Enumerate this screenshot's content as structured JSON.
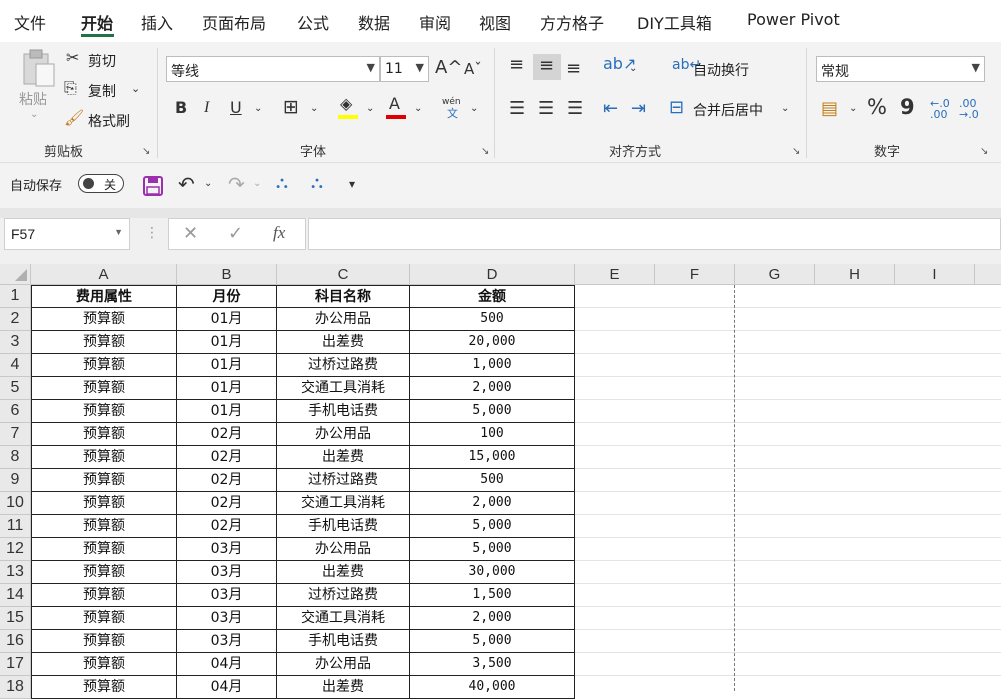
{
  "tabs": [
    "文件",
    "开始",
    "插入",
    "页面布局",
    "公式",
    "数据",
    "审阅",
    "视图",
    "方方格子",
    "DIY工具箱",
    "Power Pivot"
  ],
  "active_tab": "开始",
  "ribbon": {
    "clipboard": {
      "paste": "粘贴",
      "cut": "剪切",
      "copy": "复制",
      "format_painter": "格式刷",
      "group": "剪贴板"
    },
    "font": {
      "name": "等线",
      "size": "11",
      "bold": "B",
      "italic": "I",
      "underline": "U",
      "pinyin": "wén",
      "group": "字体"
    },
    "alignment": {
      "wrap_text": "自动换行",
      "merge_center": "合并后居中",
      "group": "对齐方式"
    },
    "number": {
      "format": "常规",
      "percent": "%",
      "comma": "9",
      "group": "数字"
    }
  },
  "qat": {
    "autosave_label": "自动保存",
    "autosave_state": "关"
  },
  "formula_bar": {
    "name_box": "F57",
    "formula": ""
  },
  "columns": [
    "A",
    "B",
    "C",
    "D",
    "E",
    "F",
    "G",
    "H",
    "I"
  ],
  "header_row": [
    "费用属性",
    "月份",
    "科目名称",
    "金额"
  ],
  "rows": [
    [
      "预算额",
      "01月",
      "办公用品",
      "500"
    ],
    [
      "预算额",
      "01月",
      "出差费",
      "20,000"
    ],
    [
      "预算额",
      "01月",
      "过桥过路费",
      "1,000"
    ],
    [
      "预算额",
      "01月",
      "交通工具消耗",
      "2,000"
    ],
    [
      "预算额",
      "01月",
      "手机电话费",
      "5,000"
    ],
    [
      "预算额",
      "02月",
      "办公用品",
      "100"
    ],
    [
      "预算额",
      "02月",
      "出差费",
      "15,000"
    ],
    [
      "预算额",
      "02月",
      "过桥过路费",
      "500"
    ],
    [
      "预算额",
      "02月",
      "交通工具消耗",
      "2,000"
    ],
    [
      "预算额",
      "02月",
      "手机电话费",
      "5,000"
    ],
    [
      "预算额",
      "03月",
      "办公用品",
      "5,000"
    ],
    [
      "预算额",
      "03月",
      "出差费",
      "30,000"
    ],
    [
      "预算额",
      "03月",
      "过桥过路费",
      "1,500"
    ],
    [
      "预算额",
      "03月",
      "交通工具消耗",
      "2,000"
    ],
    [
      "预算额",
      "03月",
      "手机电话费",
      "5,000"
    ],
    [
      "预算额",
      "04月",
      "办公用品",
      "3,500"
    ],
    [
      "预算额",
      "04月",
      "出差费",
      "40,000"
    ]
  ],
  "row_numbers": [
    "1",
    "2",
    "3",
    "4",
    "5",
    "6",
    "7",
    "8",
    "9",
    "10",
    "11",
    "12",
    "13",
    "14",
    "15",
    "16",
    "17",
    "18"
  ],
  "colors": {
    "accent": "#217346",
    "save_icon": "#9b2fae",
    "highlight": "#ffff00",
    "font_color": "#e00000"
  }
}
